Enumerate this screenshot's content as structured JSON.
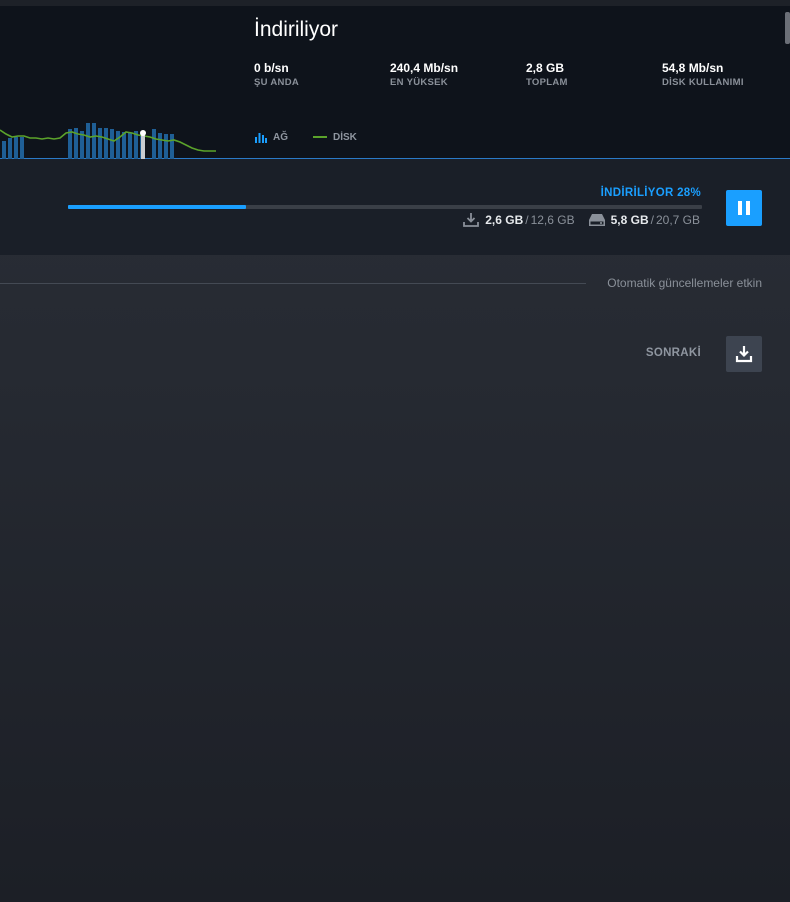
{
  "header": {
    "title": "İndiriliyor",
    "stats": [
      {
        "value": "0 b/sn",
        "label": "ŞU ANDA"
      },
      {
        "value": "240,4 Mb/sn",
        "label": "EN YÜKSEK"
      },
      {
        "value": "2,8 GB",
        "label": "TOPLAM"
      },
      {
        "value": "54,8 Mb/sn",
        "label": "DİSK KULLANIMI"
      }
    ],
    "legend": {
      "network": {
        "label": "AĞ",
        "icon": "bar-chart-icon",
        "color": "#1a9fff"
      },
      "disk": {
        "label": "DİSK",
        "icon": "line-icon",
        "color": "#5ba32b"
      }
    }
  },
  "download": {
    "status": "İNDİRİLİYOR 28%",
    "progress": 0.28,
    "downloaded": "2,6 GB",
    "download_total": "12,6 GB",
    "disk_written": "5,8 GB",
    "disk_total": "20,7 GB",
    "separator": "/",
    "pause_icon": "pause-icon",
    "accent": "#1a9fff"
  },
  "updates": {
    "auto_text": "Otomatik güncellemeler etkin"
  },
  "next": {
    "label": "SONRAKİ",
    "icon": "download-icon"
  }
}
